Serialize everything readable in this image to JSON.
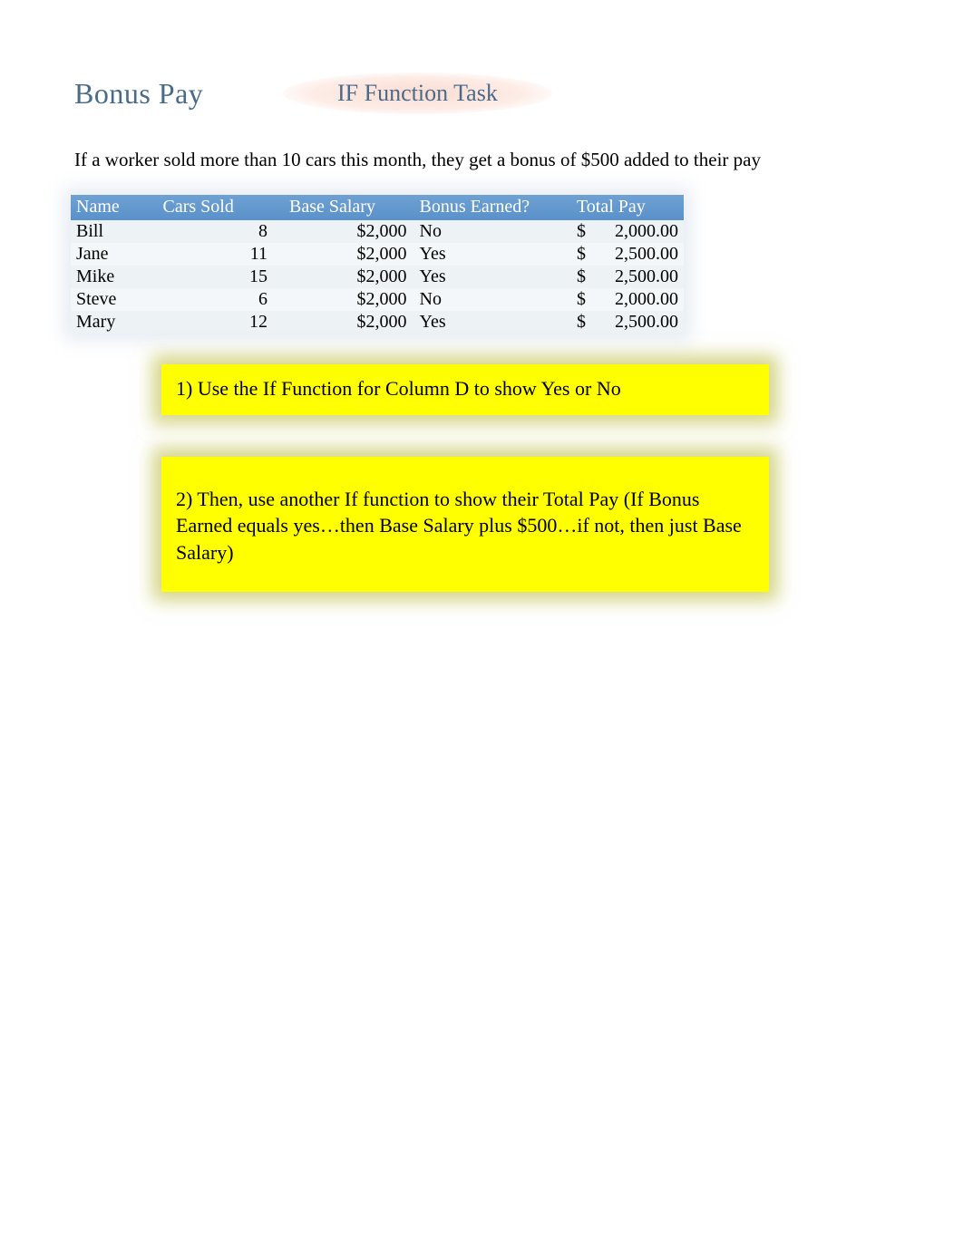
{
  "header": {
    "title": "Bonus Pay",
    "task_title": "IF Function Task"
  },
  "intro": "If a worker sold more than 10 cars this month, they get a bonus of $500 added to their pay",
  "table": {
    "columns": {
      "name": "Name",
      "cars_sold": "Cars Sold",
      "base_salary": "Base Salary",
      "bonus_earned": "Bonus Earned?",
      "total_pay": "Total Pay"
    },
    "rows": [
      {
        "name": "Bill",
        "cars_sold": "8",
        "base_salary": "$2,000",
        "bonus_earned": "No",
        "total_currency": "$",
        "total_value": "2,000.00"
      },
      {
        "name": "Jane",
        "cars_sold": "11",
        "base_salary": "$2,000",
        "bonus_earned": "Yes",
        "total_currency": "$",
        "total_value": "2,500.00"
      },
      {
        "name": "Mike",
        "cars_sold": "15",
        "base_salary": "$2,000",
        "bonus_earned": "Yes",
        "total_currency": "$",
        "total_value": "2,500.00"
      },
      {
        "name": "Steve",
        "cars_sold": "6",
        "base_salary": "$2,000",
        "bonus_earned": "No",
        "total_currency": "$",
        "total_value": "2,000.00"
      },
      {
        "name": "Mary",
        "cars_sold": "12",
        "base_salary": "$2,000",
        "bonus_earned": "Yes",
        "total_currency": "$",
        "total_value": "2,500.00"
      }
    ]
  },
  "callouts": {
    "step1": "1) Use the If Function for Column D to show Yes or No",
    "step2": "2) Then, use another If function to show their Total Pay (If Bonus Earned equals yes…then Base Salary plus $500…if not, then just Base Salary)"
  }
}
